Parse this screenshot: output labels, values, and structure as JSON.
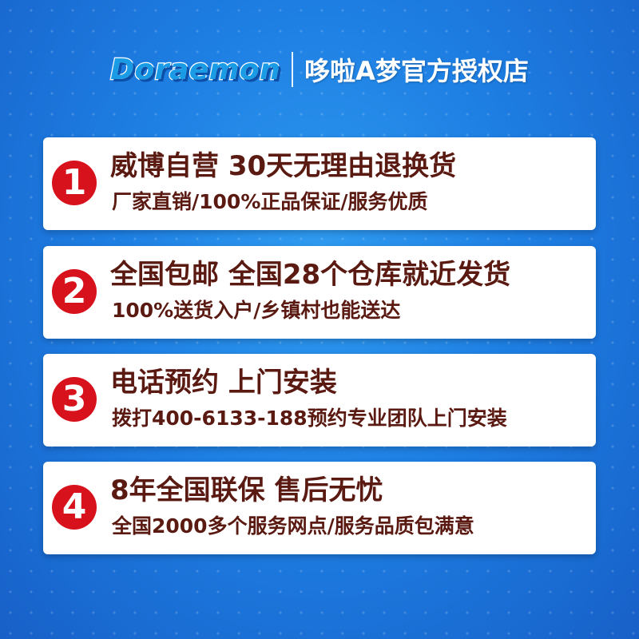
{
  "header": {
    "logo_text": "Doraemon",
    "shop_name": "哆啦A梦官方授权店"
  },
  "items": [
    {
      "number": "1",
      "title": "威博自营 30天无理由退换货",
      "subtitle": "厂家直销/100%正品保证/服务优质"
    },
    {
      "number": "2",
      "title": "全国包邮 全国28个仓库就近发货",
      "subtitle": "100%送货入户/乡镇村也能送达"
    },
    {
      "number": "3",
      "title": "电话预约 上门安装",
      "subtitle": "拨打400-6133-188预约专业团队上门安装"
    },
    {
      "number": "4",
      "title": "8年全国联保 售后无忧",
      "subtitle": "全国2000多个服务网点/服务品质包满意"
    }
  ],
  "colors": {
    "background": "#1e7fe3",
    "card": "#ffffff",
    "badge": "#d8121c",
    "text": "#5a1a12"
  }
}
